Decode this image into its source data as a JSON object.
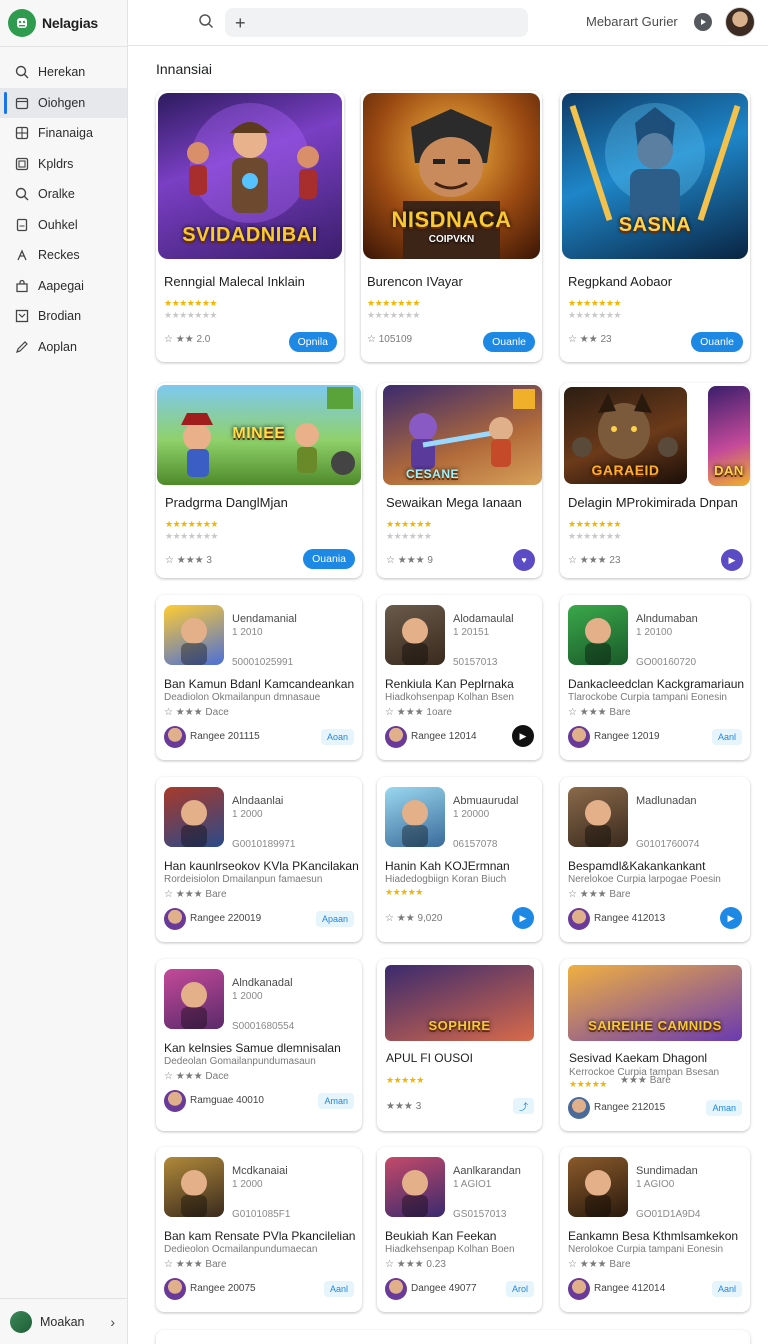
{
  "app": {
    "title": "Nelagias"
  },
  "sidebar": {
    "items": [
      {
        "label": "Herekan",
        "icon": "search-icon"
      },
      {
        "label": "Oiohgen",
        "icon": "calendar-icon",
        "active": true
      },
      {
        "label": "Finanaiga",
        "icon": "grid-icon"
      },
      {
        "label": "Kpldrs",
        "icon": "grid-icon"
      },
      {
        "label": "Oralke",
        "icon": "search-icon"
      },
      {
        "label": "Ouhkel",
        "icon": "document-icon"
      },
      {
        "label": "Reckes",
        "icon": "puzzle-icon"
      },
      {
        "label": "Aapegai",
        "icon": "bag-icon"
      },
      {
        "label": "Brodian",
        "icon": "box-icon"
      },
      {
        "label": "Aoplan",
        "icon": "pen-icon"
      }
    ],
    "footer": {
      "label": "Moakan"
    }
  },
  "topbar": {
    "user_name": "Mebarart Gurier"
  },
  "main": {
    "section_title": "Innansiai",
    "featured": [
      {
        "art_title": "SVIDADNIBAI",
        "title": "Renngial Malecal Inklain",
        "meta": "2.0",
        "button": "Opnila"
      },
      {
        "art_title": "NISDNACA",
        "art_sub": "COIPVKN",
        "title": "Burencon IVayar",
        "meta": "105109",
        "button": "Ouanle"
      },
      {
        "art_title": "SASNA",
        "title": "Regpkand Aobaor",
        "meta": "23",
        "button": "Ouanle"
      }
    ],
    "row2": [
      {
        "art_title": "MINEE",
        "title": "Pradgrma DanglMjan",
        "meta": "3",
        "button": "Ouania"
      },
      {
        "art_title": "CESANE",
        "title": "Sewaikan Mega Ianaan",
        "meta": "9"
      },
      {
        "art_title": "GARAEID",
        "title": "Delagin MProkimirada Dnpan",
        "meta": "23"
      },
      {
        "art_title": "DAN"
      }
    ],
    "list_cards": [
      {
        "head": "Uendamanial",
        "num": "1 2010",
        "id": "50001025991",
        "title": "Ban Kamun Bdanl Kamcandeankan",
        "desc": "Deadiolon Okmailanpun dmnasaue",
        "meta": "Dace",
        "user": "Rangee 201115",
        "badge": "Aoan"
      },
      {
        "head": "Alodamaulal",
        "num": "1 20151",
        "id": "50157013",
        "title": "Renkiula Kan Peplrnaka",
        "desc": "Hiadkohsenpap Kolhan Bsen",
        "meta": "1oare",
        "user": "Rangee 12014"
      },
      {
        "head": "Alndumaban",
        "num": "1 20100",
        "id": "GO00160720",
        "title": "Dankacleedclan Kackgramariaun",
        "desc": "Tlarockobe Curpia tampani Eonesin",
        "meta": "Bare",
        "user": "Rangee 12019",
        "badge": "Aanl"
      },
      {
        "head": "Alndaanlai",
        "num": "1 2000",
        "id": "G0010189971",
        "title": "Han kaunlrseokov KVla PKancilakan",
        "desc": "Rordeisiolon Dmailanpun famaesun",
        "meta": "Bare",
        "user": "Rangee 220019",
        "badge": "Apaan"
      },
      {
        "head": "Abmuaurudal",
        "num": "1 20000",
        "id": "06157078",
        "title": "Hanin Kah KOJErmnan",
        "desc": "Hiadedogbiign Koran Biuch",
        "meta": "9,020"
      },
      {
        "head": "Madlunadan",
        "num": "",
        "id": "G0101760074",
        "title": "Bespamdl&Kakankankant",
        "desc": "Nerelokoe Curpia larpogae Poesin",
        "meta": "Bare",
        "user": "Rangee 412013"
      },
      {
        "head": "Alndkanadal",
        "num": "1 2000",
        "id": "S0001680554",
        "title": "Kan kelnsies Samue dlemnisalan",
        "desc": "Dedeolan Gomailanpundumasaun",
        "meta": "Dace",
        "user": "Ramguae 40010",
        "badge": "Aman"
      },
      {
        "art_title": "SOPHIRE",
        "title": "APUL FI OUSOI",
        "meta": "3"
      },
      {
        "art_title": "SAIREIHE CAMNIDS",
        "title": "Sesivad Kaekam Dhagonl",
        "desc": "Kerrockoe Curpia tampan Bsesan",
        "meta": "Bare",
        "user": "Rangee 212015",
        "badge": "Aman"
      },
      {
        "head": "Mcdkanaiai",
        "num": "1 2000",
        "id": "G0101085F1",
        "title": "Ban kam Rensate PVla Pkancilelian",
        "desc": "Dedieolon Ocmailanpundumaecan",
        "meta": "Bare",
        "user": "Rangee 20075",
        "badge": "Aanl"
      },
      {
        "head": "Aanlkarandan",
        "num": "1 AGIO1",
        "id": "GS0157013",
        "title": "Beukiah Kan Feekan",
        "desc": "Hiadkehsenpap Kolhan Boen",
        "meta": "0.23",
        "user": "Dangee 49077",
        "badge": "Arol"
      },
      {
        "head": "Sundimadan",
        "num": "1 AGIO0",
        "id": "GO01D1A9D4",
        "title": "Eankamn Besa Kthmlsamkekon",
        "desc": "Nerolokoe Curpia tampani Eonesin",
        "meta": "Bare",
        "user": "Rangee 412014",
        "badge": "Aanl"
      }
    ]
  },
  "colors": {
    "accent": "#1e88e5",
    "sidebar_bg": "#f7f7f8",
    "brand": "#2e9b4f"
  }
}
